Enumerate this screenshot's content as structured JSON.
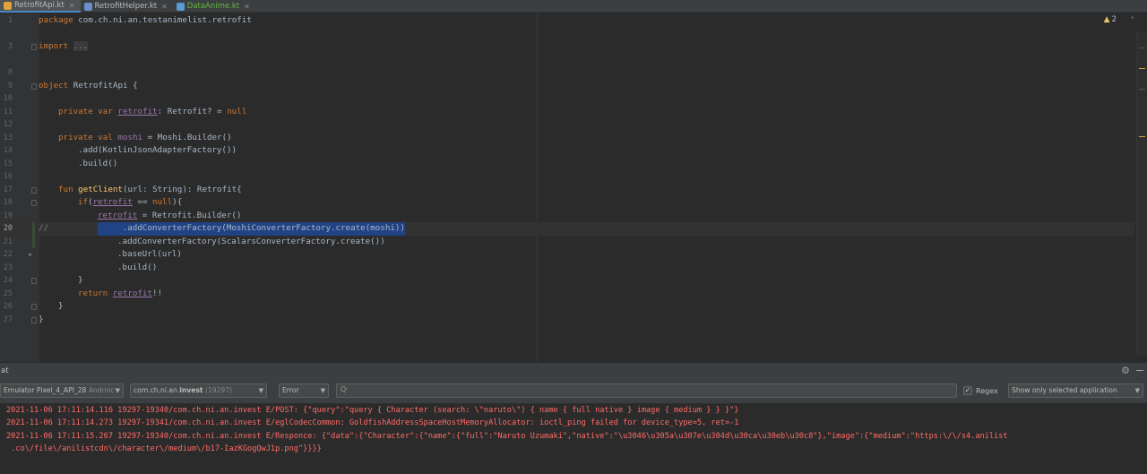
{
  "tabs": [
    {
      "label": "RetrofitApi.kt",
      "active": true
    },
    {
      "label": "RetrofitHelper.kt",
      "active": false
    },
    {
      "label": "DataAnime.kt",
      "active": false
    }
  ],
  "editor": {
    "line_numbers": {
      "l1": "1",
      "l3": "3",
      "l8": "8",
      "l9": "9",
      "l10": "10",
      "l11": "11",
      "l12": "12",
      "l13": "13",
      "l14": "14",
      "l15": "15",
      "l16": "16",
      "l17": "17",
      "l18": "18",
      "l19": "19",
      "l20": "20",
      "l21": "21",
      "l22": "22",
      "l23": "23",
      "l24": "24",
      "l25": "25",
      "l26": "26",
      "l27": "27"
    },
    "code": {
      "package_kw": "package",
      "package_name": " com.ch.ni.an.testanimelist.retrofit",
      "import_kw": "import",
      "import_fold": "...",
      "object_kw": "object",
      "object_name": " RetrofitApi {",
      "l11_kw": "private var",
      "l11_prop": "retrofit",
      "l11_rest": ": Retrofit? = ",
      "l11_null": "null",
      "l13_kw": "private val",
      "l13_prop": "moshi",
      "l13_rest": " = Moshi.Builder()",
      "l14": ".add(KotlinJsonAdapterFactory())",
      "l15": ".build()",
      "l17_kw": "fun",
      "l17_fn": "getClient",
      "l17_rest": "(url: String): Retrofit{",
      "l18_kw": "if",
      "l18_prop": "retrofit",
      "l18_mid": " == ",
      "l18_null": "null",
      "l18_end": "){",
      "l19_prop": "retrofit",
      "l19_rest": " = Retrofit.Builder()",
      "l20_comment": "//",
      "l20_sel": "     .addConverterFactory(MoshiConverterFactory.create(moshi))",
      "l21": ".addConverterFactory(ScalarsConverterFactory.create())",
      "l22": ".baseUrl(url)",
      "l23": ".build()",
      "l24": "}",
      "l25_kw": "return",
      "l25_prop": "retrofit",
      "l25_end": "!!",
      "l26": "}",
      "l27": "}"
    },
    "warning_count": "2"
  },
  "logcat": {
    "title": "at",
    "device": "Emulator Pixel_4_API_28",
    "device_suffix": "Androic",
    "process_prefix": "com.ch.ni.an.",
    "process_bold": "invest",
    "process_pid": " (19297)",
    "level": "Error",
    "search_placeholder": "Q·",
    "regex_label": "Regex",
    "regex_checked": true,
    "filter": "Show only selected application",
    "lines": [
      "2021-11-06 17:11:14.116 19297-19340/com.ch.ni.an.invest E/POST: {\"query\":\"query { Character (search: \\\"naruto\\\") { name { full native } image { medium } } }\"}",
      "2021-11-06 17:11:14.273 19297-19341/com.ch.ni.an.invest E/eglCodecCommon: GoldfishAddressSpaceHostMemoryAllocator: ioctl_ping failed for device_type=5, ret=-1",
      "2021-11-06 17:11:15.267 19297-19340/com.ch.ni.an.invest E/Responce: {\"data\":{\"Character\":{\"name\":{\"full\":\"Naruto Uzumaki\",\"native\":\"\\u3046\\u305a\\u307e\\u304d\\u30ca\\u30eb\\u30c8\"},\"image\":{\"medium\":\"https:\\/\\/s4.anilist",
      " .co\\/file\\/anilistcdn\\/character\\/medium\\/b17-IazKGogQwJ1p.png\"}}}}"
    ]
  },
  "colors": {
    "background": "#2b2b2b",
    "keyword": "#cc7832",
    "function": "#ffc66d",
    "property": "#9876aa",
    "selection": "#214283",
    "log_error": "#ff6b68"
  }
}
